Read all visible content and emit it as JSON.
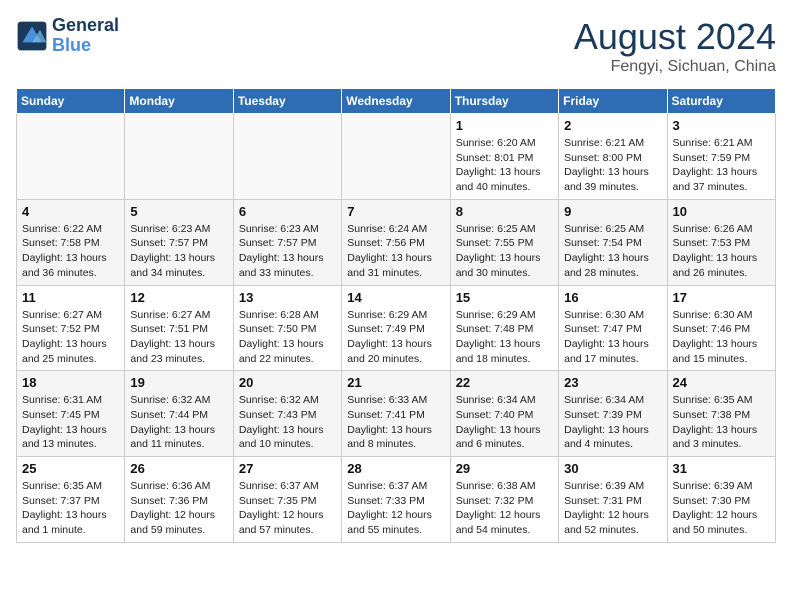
{
  "logo": {
    "line1": "General",
    "line2": "Blue"
  },
  "title": "August 2024",
  "subtitle": "Fengyi, Sichuan, China",
  "days": [
    "Sunday",
    "Monday",
    "Tuesday",
    "Wednesday",
    "Thursday",
    "Friday",
    "Saturday"
  ],
  "weeks": [
    [
      {
        "date": "",
        "info": ""
      },
      {
        "date": "",
        "info": ""
      },
      {
        "date": "",
        "info": ""
      },
      {
        "date": "",
        "info": ""
      },
      {
        "date": "1",
        "info": "Sunrise: 6:20 AM\nSunset: 8:01 PM\nDaylight: 13 hours\nand 40 minutes."
      },
      {
        "date": "2",
        "info": "Sunrise: 6:21 AM\nSunset: 8:00 PM\nDaylight: 13 hours\nand 39 minutes."
      },
      {
        "date": "3",
        "info": "Sunrise: 6:21 AM\nSunset: 7:59 PM\nDaylight: 13 hours\nand 37 minutes."
      }
    ],
    [
      {
        "date": "4",
        "info": "Sunrise: 6:22 AM\nSunset: 7:58 PM\nDaylight: 13 hours\nand 36 minutes."
      },
      {
        "date": "5",
        "info": "Sunrise: 6:23 AM\nSunset: 7:57 PM\nDaylight: 13 hours\nand 34 minutes."
      },
      {
        "date": "6",
        "info": "Sunrise: 6:23 AM\nSunset: 7:57 PM\nDaylight: 13 hours\nand 33 minutes."
      },
      {
        "date": "7",
        "info": "Sunrise: 6:24 AM\nSunset: 7:56 PM\nDaylight: 13 hours\nand 31 minutes."
      },
      {
        "date": "8",
        "info": "Sunrise: 6:25 AM\nSunset: 7:55 PM\nDaylight: 13 hours\nand 30 minutes."
      },
      {
        "date": "9",
        "info": "Sunrise: 6:25 AM\nSunset: 7:54 PM\nDaylight: 13 hours\nand 28 minutes."
      },
      {
        "date": "10",
        "info": "Sunrise: 6:26 AM\nSunset: 7:53 PM\nDaylight: 13 hours\nand 26 minutes."
      }
    ],
    [
      {
        "date": "11",
        "info": "Sunrise: 6:27 AM\nSunset: 7:52 PM\nDaylight: 13 hours\nand 25 minutes."
      },
      {
        "date": "12",
        "info": "Sunrise: 6:27 AM\nSunset: 7:51 PM\nDaylight: 13 hours\nand 23 minutes."
      },
      {
        "date": "13",
        "info": "Sunrise: 6:28 AM\nSunset: 7:50 PM\nDaylight: 13 hours\nand 22 minutes."
      },
      {
        "date": "14",
        "info": "Sunrise: 6:29 AM\nSunset: 7:49 PM\nDaylight: 13 hours\nand 20 minutes."
      },
      {
        "date": "15",
        "info": "Sunrise: 6:29 AM\nSunset: 7:48 PM\nDaylight: 13 hours\nand 18 minutes."
      },
      {
        "date": "16",
        "info": "Sunrise: 6:30 AM\nSunset: 7:47 PM\nDaylight: 13 hours\nand 17 minutes."
      },
      {
        "date": "17",
        "info": "Sunrise: 6:30 AM\nSunset: 7:46 PM\nDaylight: 13 hours\nand 15 minutes."
      }
    ],
    [
      {
        "date": "18",
        "info": "Sunrise: 6:31 AM\nSunset: 7:45 PM\nDaylight: 13 hours\nand 13 minutes."
      },
      {
        "date": "19",
        "info": "Sunrise: 6:32 AM\nSunset: 7:44 PM\nDaylight: 13 hours\nand 11 minutes."
      },
      {
        "date": "20",
        "info": "Sunrise: 6:32 AM\nSunset: 7:43 PM\nDaylight: 13 hours\nand 10 minutes."
      },
      {
        "date": "21",
        "info": "Sunrise: 6:33 AM\nSunset: 7:41 PM\nDaylight: 13 hours\nand 8 minutes."
      },
      {
        "date": "22",
        "info": "Sunrise: 6:34 AM\nSunset: 7:40 PM\nDaylight: 13 hours\nand 6 minutes."
      },
      {
        "date": "23",
        "info": "Sunrise: 6:34 AM\nSunset: 7:39 PM\nDaylight: 13 hours\nand 4 minutes."
      },
      {
        "date": "24",
        "info": "Sunrise: 6:35 AM\nSunset: 7:38 PM\nDaylight: 13 hours\nand 3 minutes."
      }
    ],
    [
      {
        "date": "25",
        "info": "Sunrise: 6:35 AM\nSunset: 7:37 PM\nDaylight: 13 hours\nand 1 minute."
      },
      {
        "date": "26",
        "info": "Sunrise: 6:36 AM\nSunset: 7:36 PM\nDaylight: 12 hours\nand 59 minutes."
      },
      {
        "date": "27",
        "info": "Sunrise: 6:37 AM\nSunset: 7:35 PM\nDaylight: 12 hours\nand 57 minutes."
      },
      {
        "date": "28",
        "info": "Sunrise: 6:37 AM\nSunset: 7:33 PM\nDaylight: 12 hours\nand 55 minutes."
      },
      {
        "date": "29",
        "info": "Sunrise: 6:38 AM\nSunset: 7:32 PM\nDaylight: 12 hours\nand 54 minutes."
      },
      {
        "date": "30",
        "info": "Sunrise: 6:39 AM\nSunset: 7:31 PM\nDaylight: 12 hours\nand 52 minutes."
      },
      {
        "date": "31",
        "info": "Sunrise: 6:39 AM\nSunset: 7:30 PM\nDaylight: 12 hours\nand 50 minutes."
      }
    ]
  ]
}
